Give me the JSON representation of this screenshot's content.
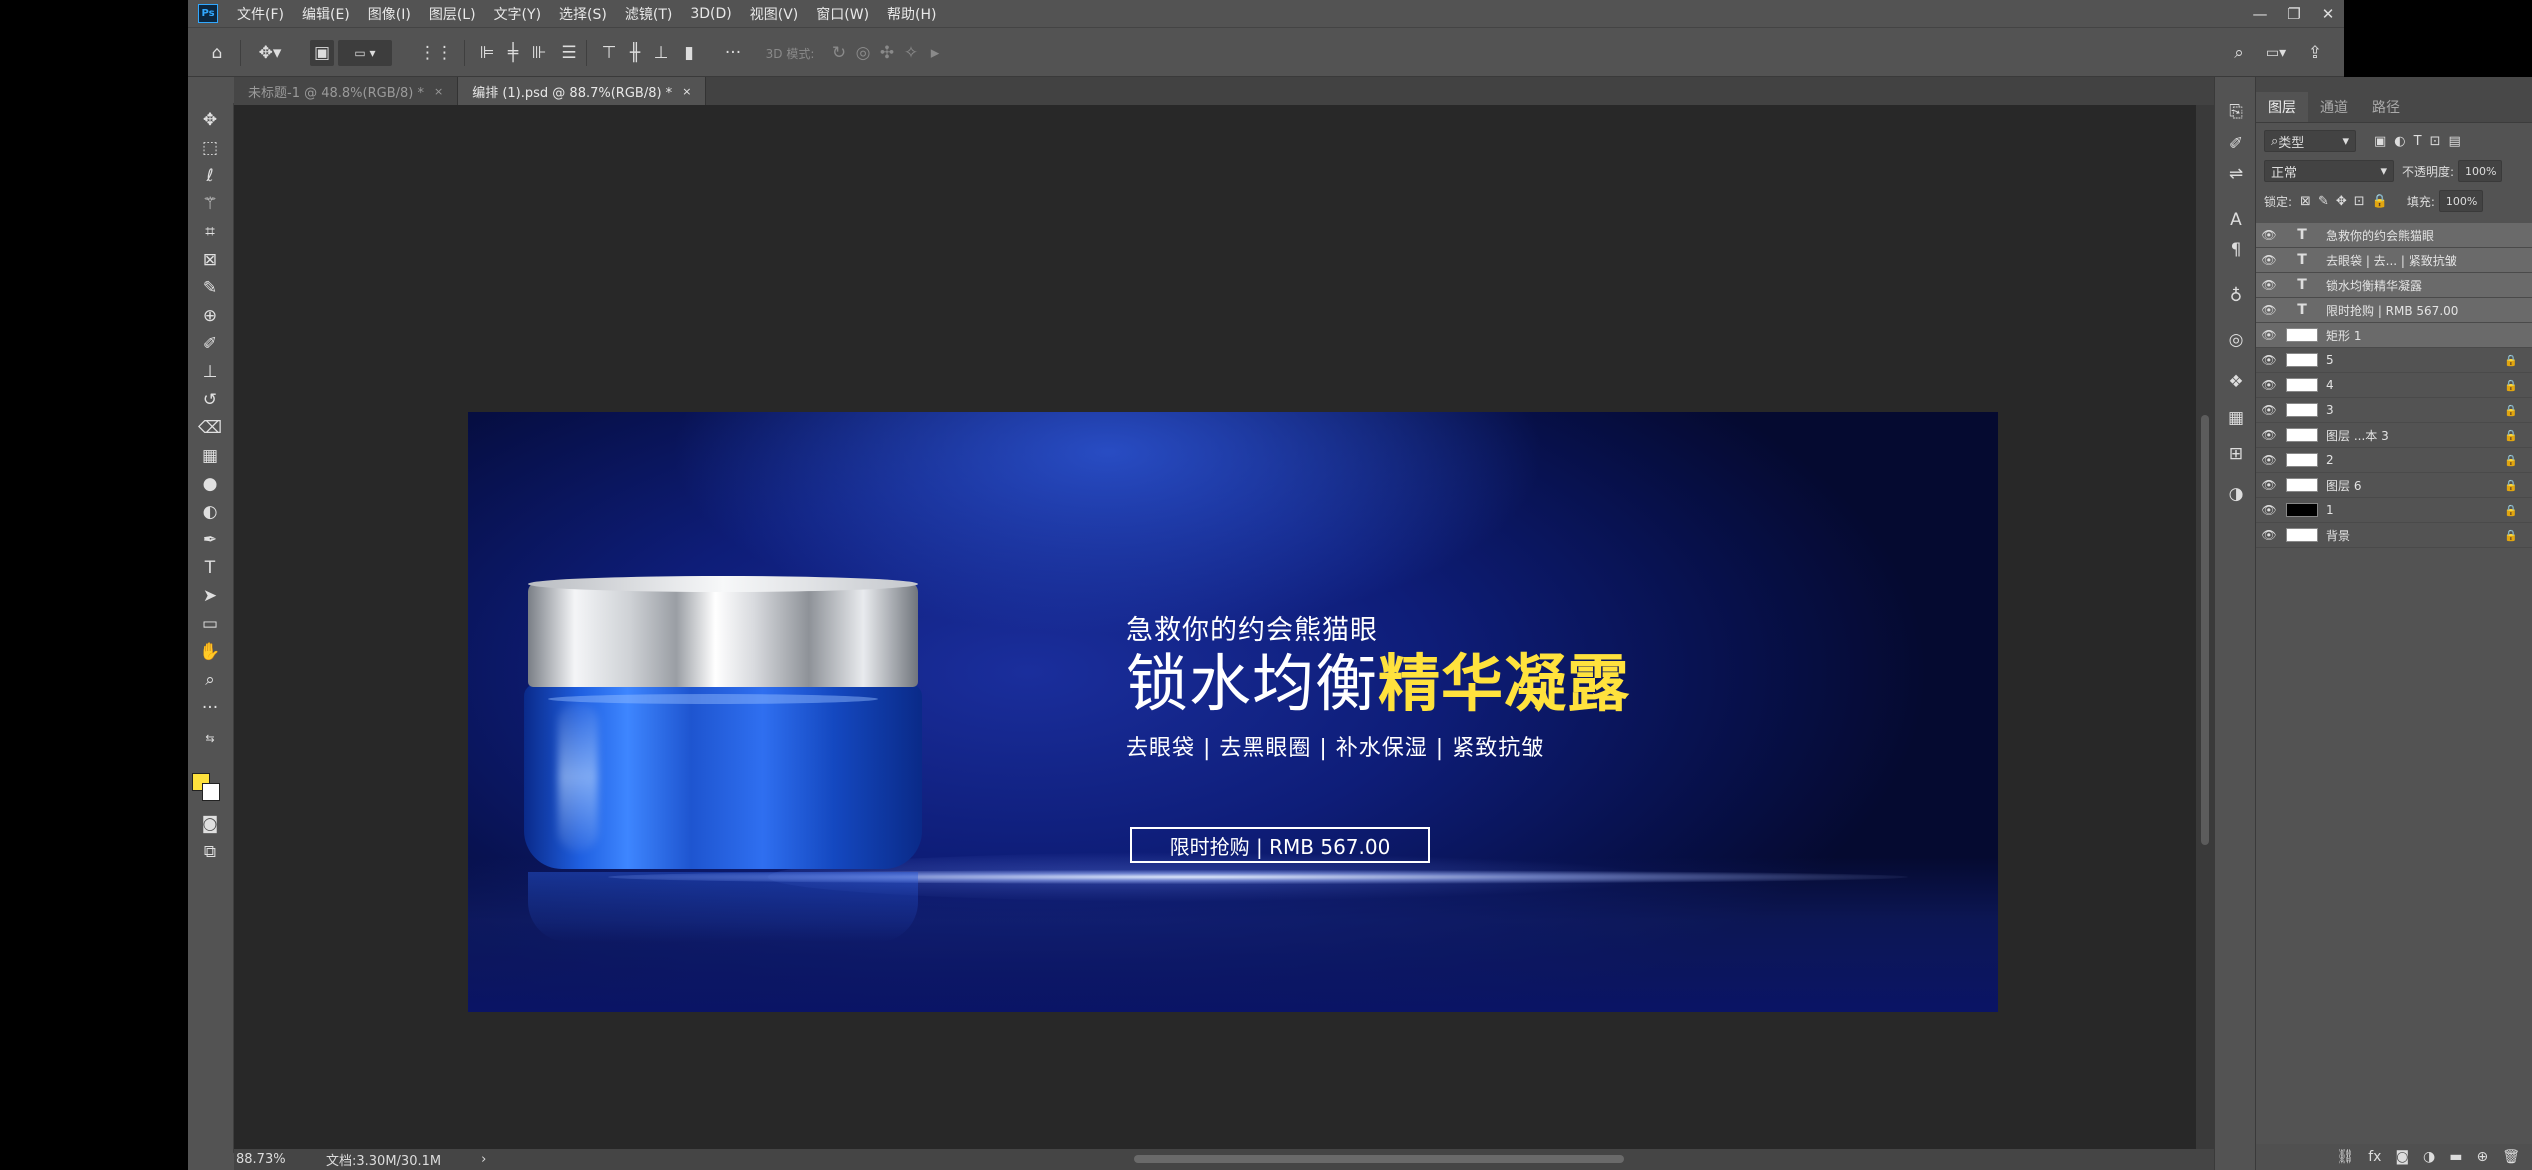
{
  "menubar": {
    "logo": "Ps",
    "items": [
      "文件(F)",
      "编辑(E)",
      "图像(I)",
      "图层(L)",
      "文字(Y)",
      "选择(S)",
      "滤镜(T)",
      "3D(D)",
      "视图(V)",
      "窗口(W)",
      "帮助(H)"
    ],
    "minimize": "—",
    "restore": "❐",
    "close": "✕"
  },
  "options": {
    "mode_3d": "3D 模式:"
  },
  "tabs": [
    {
      "label": "未标题-1 @ 48.8%(RGB/8) *",
      "close": "×"
    },
    {
      "label": "编排 (1).psd @ 88.7%(RGB/8) *",
      "close": "×"
    }
  ],
  "banner": {
    "subtitle": "急救你的约会熊猫眼",
    "title_white": "锁水均衡",
    "title_yellow": "精华凝露",
    "tags": "去眼袋 | 去黑眼圈 | 补水保湿 | 紧致抗皱",
    "button": "限时抢购 | RMB 567.00",
    "accent_color": "#ffe23d"
  },
  "status": {
    "zoom": "88.73%",
    "doc": "文档:3.30M/30.1M",
    "arrow": "›"
  },
  "panel": {
    "tabs": [
      "图层",
      "通道",
      "路径"
    ],
    "filter_label": "类型",
    "blend_mode": "正常",
    "opacity_label": "不透明度:",
    "opacity_value": "100%",
    "lock_label": "锁定:",
    "fill_label": "填充:",
    "fill_value": "100%"
  },
  "layers": [
    {
      "name": "急救你的约会熊猫眼",
      "kind": "text",
      "selected": true
    },
    {
      "name": "去眼袋 | 去... | 紧致抗皱",
      "kind": "text",
      "selected": true
    },
    {
      "name": "锁水均衡精华凝露",
      "kind": "text",
      "selected": true
    },
    {
      "name": "限时抢购 | RMB 567.00",
      "kind": "text",
      "selected": true
    },
    {
      "name": "矩形 1",
      "kind": "shape",
      "selected": true
    },
    {
      "name": "5",
      "kind": "image",
      "selected": false
    },
    {
      "name": "4",
      "kind": "image",
      "selected": false
    },
    {
      "name": "3",
      "kind": "image",
      "selected": false
    },
    {
      "name": "图层 ...本 3",
      "kind": "image",
      "selected": false
    },
    {
      "name": "2",
      "kind": "image",
      "selected": false
    },
    {
      "name": "图层 6",
      "kind": "image",
      "selected": false
    },
    {
      "name": "1",
      "kind": "dark",
      "selected": false
    },
    {
      "name": "背景",
      "kind": "image",
      "selected": false
    }
  ]
}
